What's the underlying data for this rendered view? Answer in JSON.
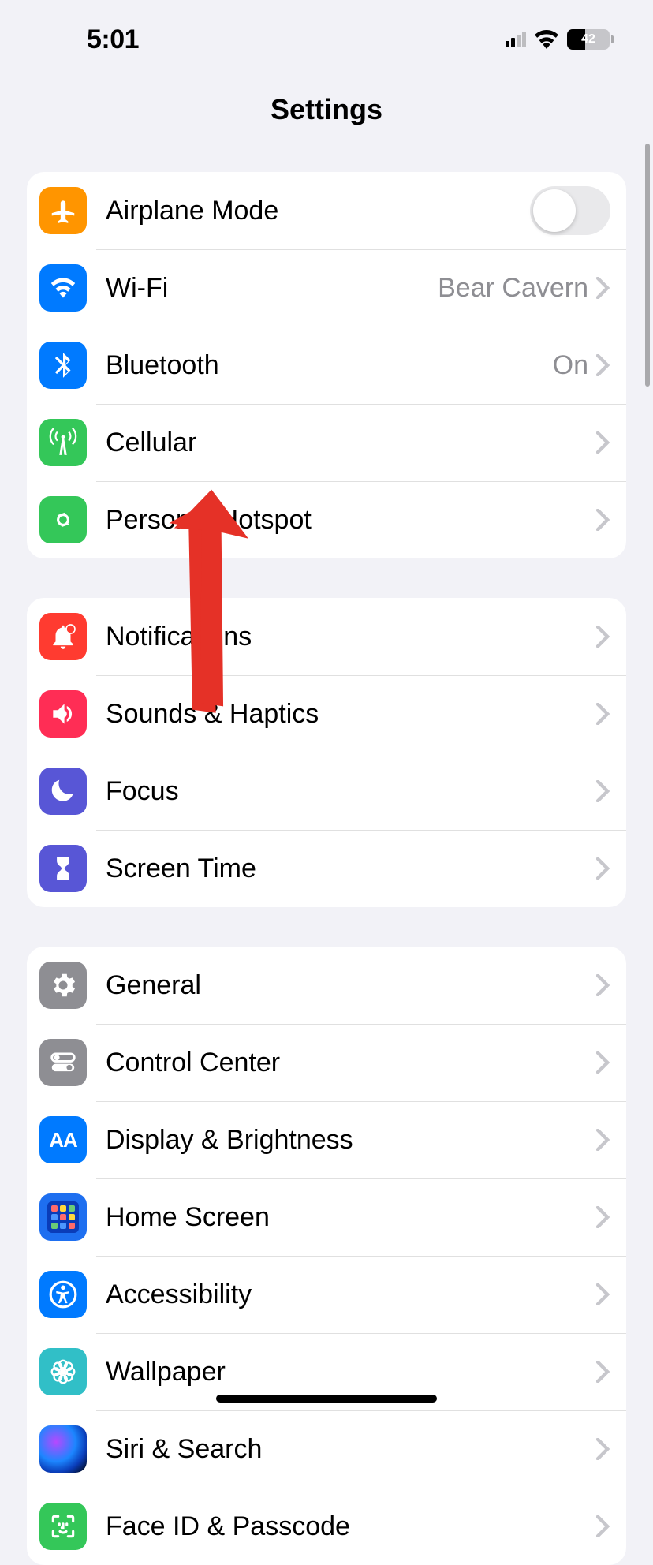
{
  "status": {
    "time": "5:01",
    "battery": "42"
  },
  "header": {
    "title": "Settings"
  },
  "groups": [
    {
      "rows": [
        {
          "id": "airplane",
          "label": "Airplane Mode",
          "type": "toggle",
          "on": false,
          "icon": "airplane",
          "color": "orange"
        },
        {
          "id": "wifi",
          "label": "Wi-Fi",
          "detail": "Bear Cavern",
          "type": "nav",
          "icon": "wifi",
          "color": "blue"
        },
        {
          "id": "bluetooth",
          "label": "Bluetooth",
          "detail": "On",
          "type": "nav",
          "icon": "bluetooth",
          "color": "blue"
        },
        {
          "id": "cellular",
          "label": "Cellular",
          "type": "nav",
          "icon": "cell-tower",
          "color": "green"
        },
        {
          "id": "hotspot",
          "label": "Personal Hotspot",
          "type": "nav",
          "icon": "link",
          "color": "green"
        }
      ]
    },
    {
      "rows": [
        {
          "id": "notifications",
          "label": "Notifications",
          "type": "nav",
          "icon": "bell",
          "color": "red"
        },
        {
          "id": "sounds",
          "label": "Sounds & Haptics",
          "type": "nav",
          "icon": "speaker",
          "color": "pink"
        },
        {
          "id": "focus",
          "label": "Focus",
          "type": "nav",
          "icon": "moon",
          "color": "indigo"
        },
        {
          "id": "screentime",
          "label": "Screen Time",
          "type": "nav",
          "icon": "hourglass",
          "color": "indigo"
        }
      ]
    },
    {
      "rows": [
        {
          "id": "general",
          "label": "General",
          "type": "nav",
          "icon": "gear",
          "color": "gray"
        },
        {
          "id": "controlcenter",
          "label": "Control Center",
          "type": "nav",
          "icon": "switches",
          "color": "gray"
        },
        {
          "id": "display",
          "label": "Display & Brightness",
          "type": "nav",
          "icon": "aa",
          "color": "blue"
        },
        {
          "id": "homescreen",
          "label": "Home Screen",
          "type": "nav",
          "icon": "apps",
          "color": "appsblue"
        },
        {
          "id": "accessibility",
          "label": "Accessibility",
          "type": "nav",
          "icon": "accessibility",
          "color": "blue"
        },
        {
          "id": "wallpaper",
          "label": "Wallpaper",
          "type": "nav",
          "icon": "flower",
          "color": "teal"
        },
        {
          "id": "siri",
          "label": "Siri & Search",
          "type": "nav",
          "icon": "siri",
          "color": "siri"
        },
        {
          "id": "faceid",
          "label": "Face ID & Passcode",
          "type": "nav",
          "icon": "faceid",
          "color": "faceid"
        }
      ]
    }
  ]
}
